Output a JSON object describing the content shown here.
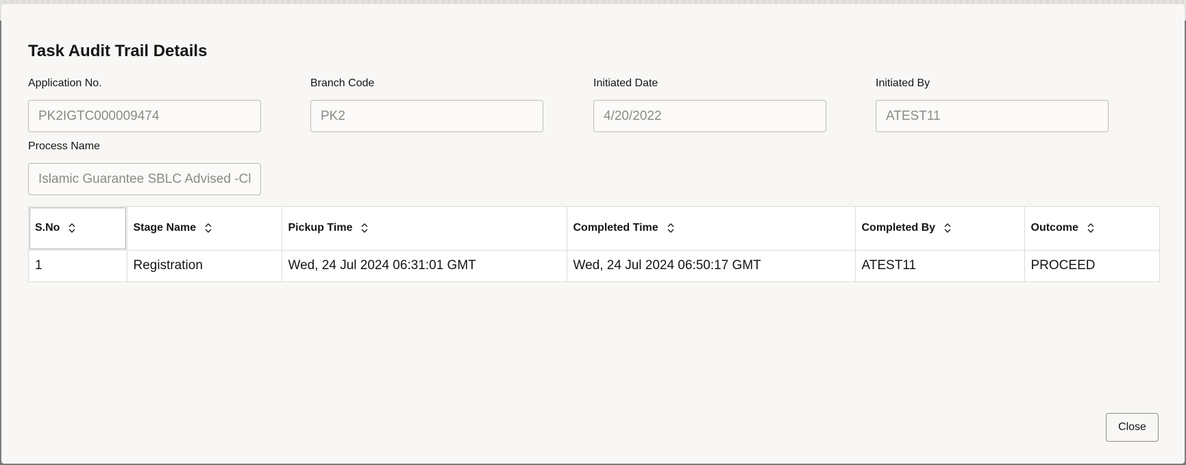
{
  "dialog": {
    "title": "Task Audit Trail Details",
    "close_label": "Close"
  },
  "fields": {
    "application_no": {
      "label": "Application No.",
      "value": "PK2IGTC000009474"
    },
    "branch_code": {
      "label": "Branch Code",
      "value": "PK2"
    },
    "initiated_date": {
      "label": "Initiated Date",
      "value": "4/20/2022"
    },
    "initiated_by": {
      "label": "Initiated By",
      "value": "ATEST11"
    },
    "process_name": {
      "label": "Process Name",
      "value": "Islamic Guarantee SBLC Advised -Cla"
    }
  },
  "table": {
    "columns": [
      "S.No",
      "Stage Name",
      "Pickup Time",
      "Completed Time",
      "Completed By",
      "Outcome"
    ],
    "rows": [
      [
        "1",
        "Registration",
        "Wed, 24 Jul 2024 06:31:01 GMT",
        "Wed, 24 Jul 2024 06:50:17 GMT",
        "ATEST11",
        "PROCEED"
      ]
    ]
  },
  "icons": {
    "sort": "sort-up-down-icon"
  },
  "colors": {
    "dialog_bg": "#f8f7f5",
    "text": "#161513",
    "field_text": "#8c8a86",
    "border": "#dedbd7"
  }
}
